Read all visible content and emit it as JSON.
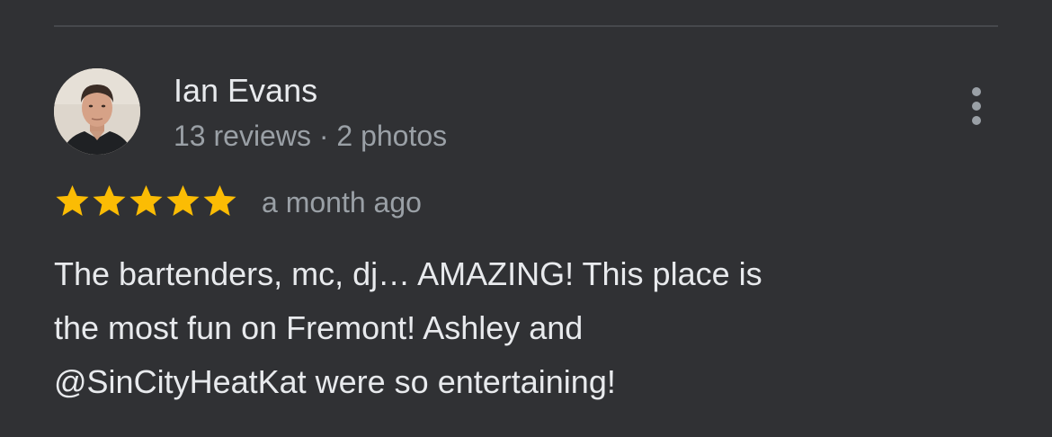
{
  "review": {
    "author": {
      "name": "Ian Evans",
      "meta": "13 reviews · 2 photos",
      "avatar": "profile-photo"
    },
    "rating": {
      "stars": 5,
      "max": 5,
      "star_color": "#fbbc04"
    },
    "date": "a month ago",
    "text_lines": [
      "The bartenders, mc, dj… AMAZING! This place is",
      "the most fun on Fremont! Ashley and",
      "@SinCityHeatKat were so entertaining!"
    ],
    "more_icon": "more-vert-icon"
  },
  "colors": {
    "background": "#303134",
    "primary_text": "#e8eaed",
    "secondary_text": "#9aa0a6",
    "divider": "#46484c"
  }
}
